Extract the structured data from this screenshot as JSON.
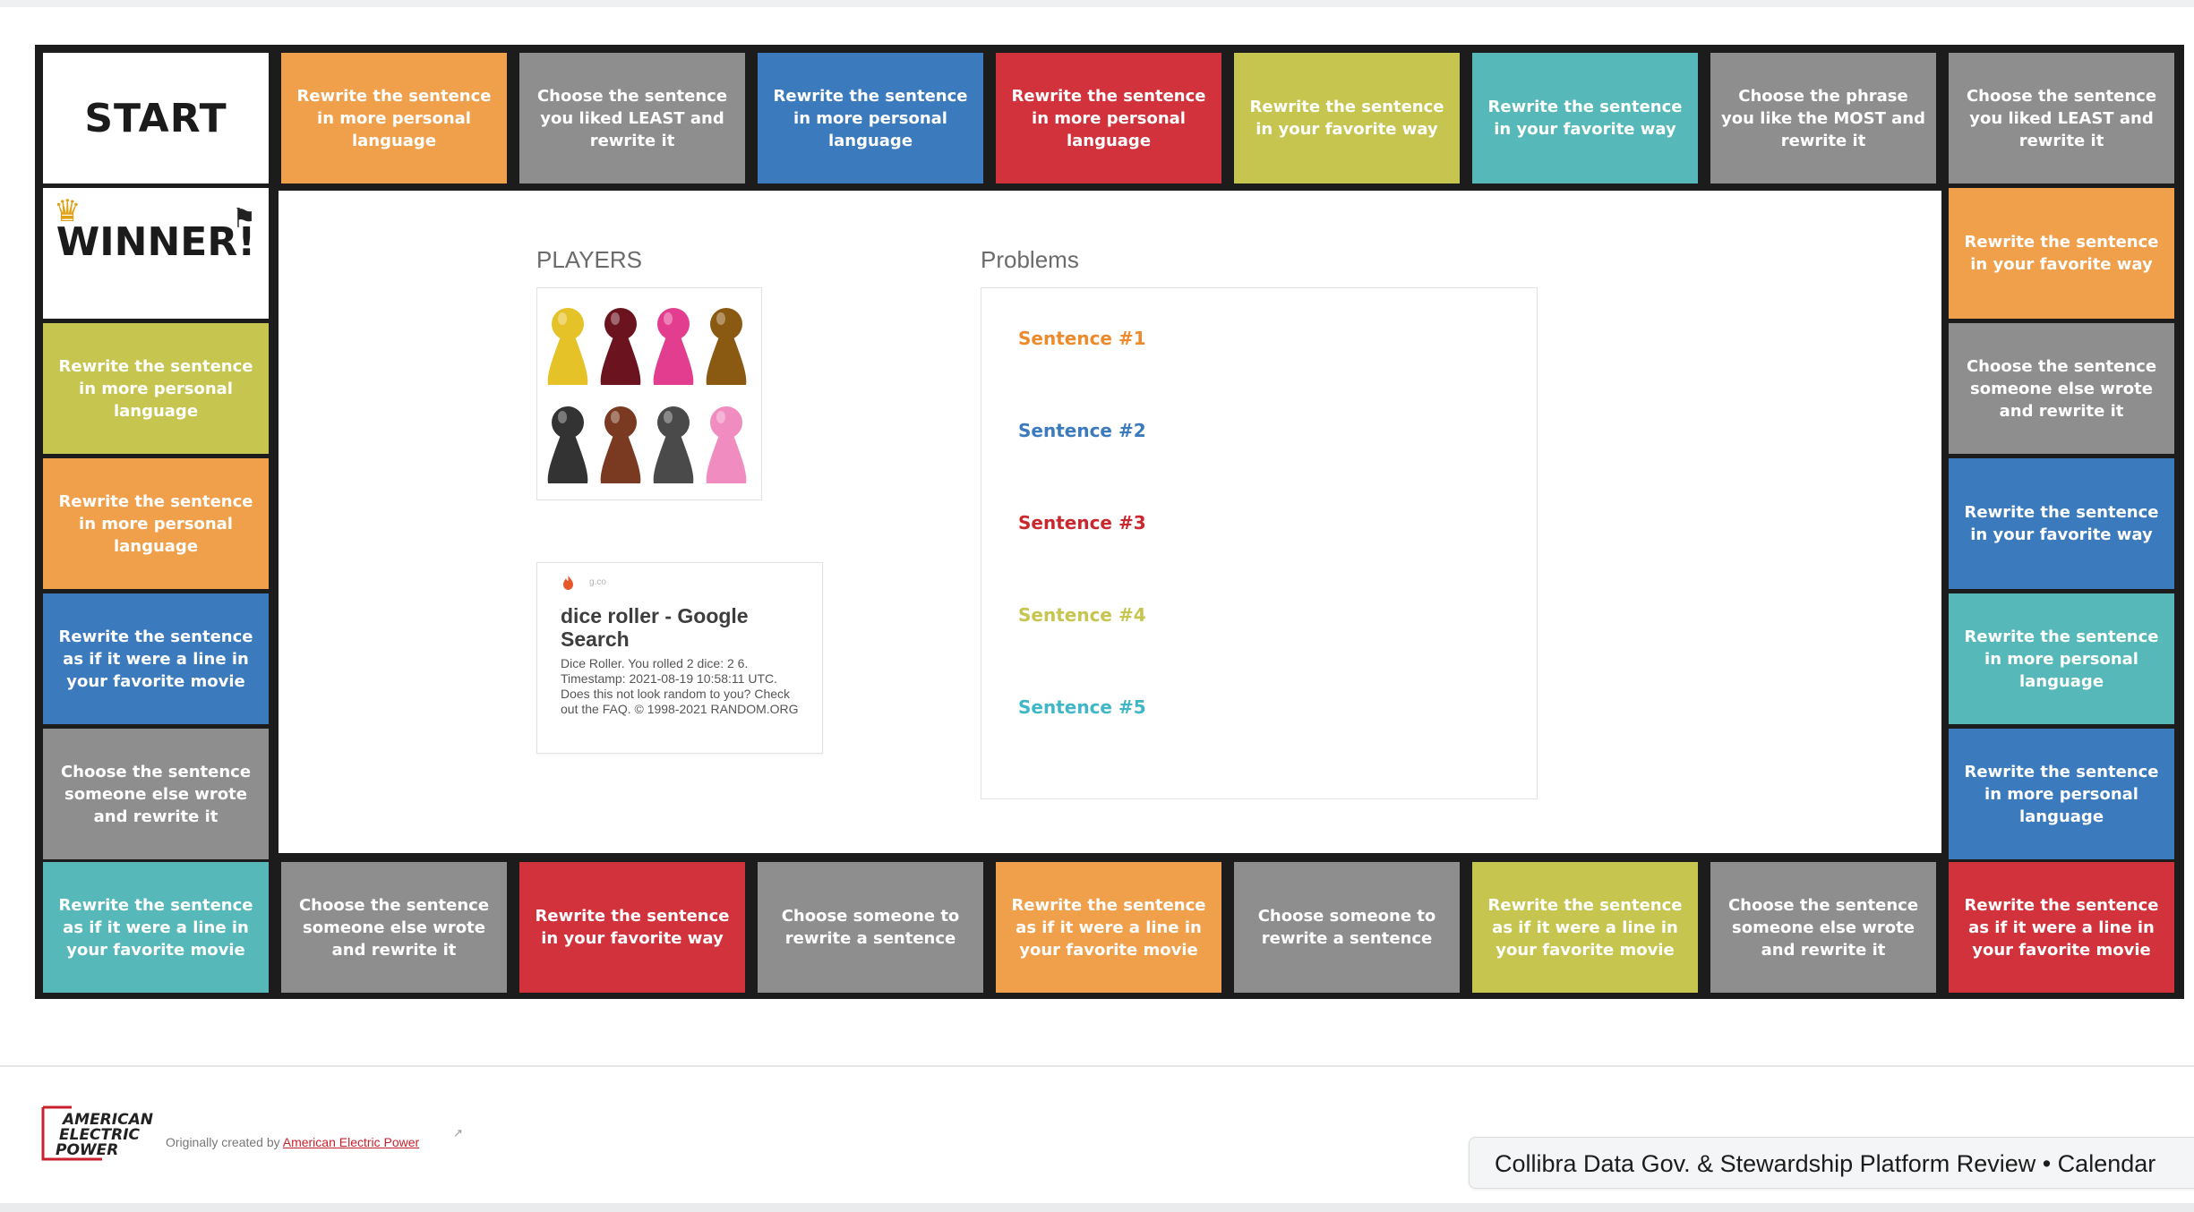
{
  "board": {
    "start_label": "START",
    "winner_label": "WINNER!",
    "top_row": [
      {
        "text": "Rewrite the sentence in more personal language",
        "color": "orange"
      },
      {
        "text": "Choose the sentence you liked LEAST and rewrite it",
        "color": "gray"
      },
      {
        "text": "Rewrite the sentence in more personal language",
        "color": "blue"
      },
      {
        "text": "Rewrite the sentence in more personal language",
        "color": "red"
      },
      {
        "text": "Rewrite the sentence in your favorite way",
        "color": "olive"
      },
      {
        "text": "Rewrite the sentence in your favorite way",
        "color": "teal"
      },
      {
        "text": "Choose the phrase you like the MOST and rewrite it",
        "color": "gray"
      },
      {
        "text": "Choose the sentence you liked LEAST and rewrite it",
        "color": "gray"
      }
    ],
    "left_col": [
      {
        "text": "Rewrite the sentence in more personal language",
        "color": "olive"
      },
      {
        "text": "Rewrite the sentence in more personal language",
        "color": "orange"
      },
      {
        "text": "Rewrite the sentence as if it were a line in your favorite movie",
        "color": "blue"
      },
      {
        "text": "Choose the sentence someone else wrote and rewrite it",
        "color": "gray"
      }
    ],
    "right_col": [
      {
        "text": "Rewrite the sentence in your favorite way",
        "color": "orange"
      },
      {
        "text": "Choose the sentence someone else wrote and rewrite it",
        "color": "gray"
      },
      {
        "text": "Rewrite the sentence in your favorite way",
        "color": "blue"
      },
      {
        "text": "Rewrite the sentence in more personal language",
        "color": "teal"
      },
      {
        "text": "Rewrite the sentence in more personal language",
        "color": "blue"
      }
    ],
    "bottom_row": [
      {
        "text": "Rewrite the sentence as if it were a line in your favorite movie",
        "color": "teal"
      },
      {
        "text": "Choose the sentence someone else wrote and rewrite it",
        "color": "gray"
      },
      {
        "text": "Rewrite the sentence in your favorite way",
        "color": "red"
      },
      {
        "text": "Choose someone to rewrite a sentence",
        "color": "gray"
      },
      {
        "text": "Rewrite the sentence as if it were a line in your favorite movie",
        "color": "orange"
      },
      {
        "text": "Choose someone to rewrite a sentence",
        "color": "gray"
      },
      {
        "text": "Rewrite the sentence as if it were a line in your favorite movie",
        "color": "olive"
      },
      {
        "text": "Choose the sentence someone else wrote and rewrite it",
        "color": "gray"
      },
      {
        "text": "Rewrite the sentence as if it were a line in your favorite movie",
        "color": "red"
      }
    ]
  },
  "players": {
    "label": "PLAYERS",
    "pawn_colors": [
      "#e6c229",
      "#6b1420",
      "#e33d8f",
      "#8a5a12",
      "#333333",
      "#7a3a22",
      "#4a4a4a",
      "#f08cc0"
    ]
  },
  "search_card": {
    "source": "g.co",
    "title": "dice roller - Google Search",
    "description": "Dice Roller. You rolled 2 dice: 2 6. Timestamp: 2021-08-19 10:58:11 UTC. Does this not look random to you? Check out the FAQ. © 1998-2021 RANDOM.ORG"
  },
  "problems": {
    "label": "Problems",
    "sentences": [
      {
        "text": "Sentence #1",
        "color": "#ee8a2e"
      },
      {
        "text": "Sentence #2",
        "color": "#3a7abd"
      },
      {
        "text": "Sentence #3",
        "color": "#c9282e"
      },
      {
        "text": "Sentence #4",
        "color": "#c6c54f"
      },
      {
        "text": "Sentence #5",
        "color": "#3fb7c7"
      }
    ]
  },
  "footer": {
    "logo_text": "AMERICAN ELECTRIC POWER",
    "credit_prefix": "Originally created by ",
    "credit_link": "American Electric Power",
    "calendar_pill": "Collibra Data Gov. & Stewardship Platform Review • Calendar"
  },
  "colors": {
    "orange": "#f0a04b",
    "gray": "#8e8e8e",
    "blue": "#3a7abd",
    "red": "#d2323c",
    "olive": "#c6c54f",
    "teal": "#56b8b8"
  }
}
